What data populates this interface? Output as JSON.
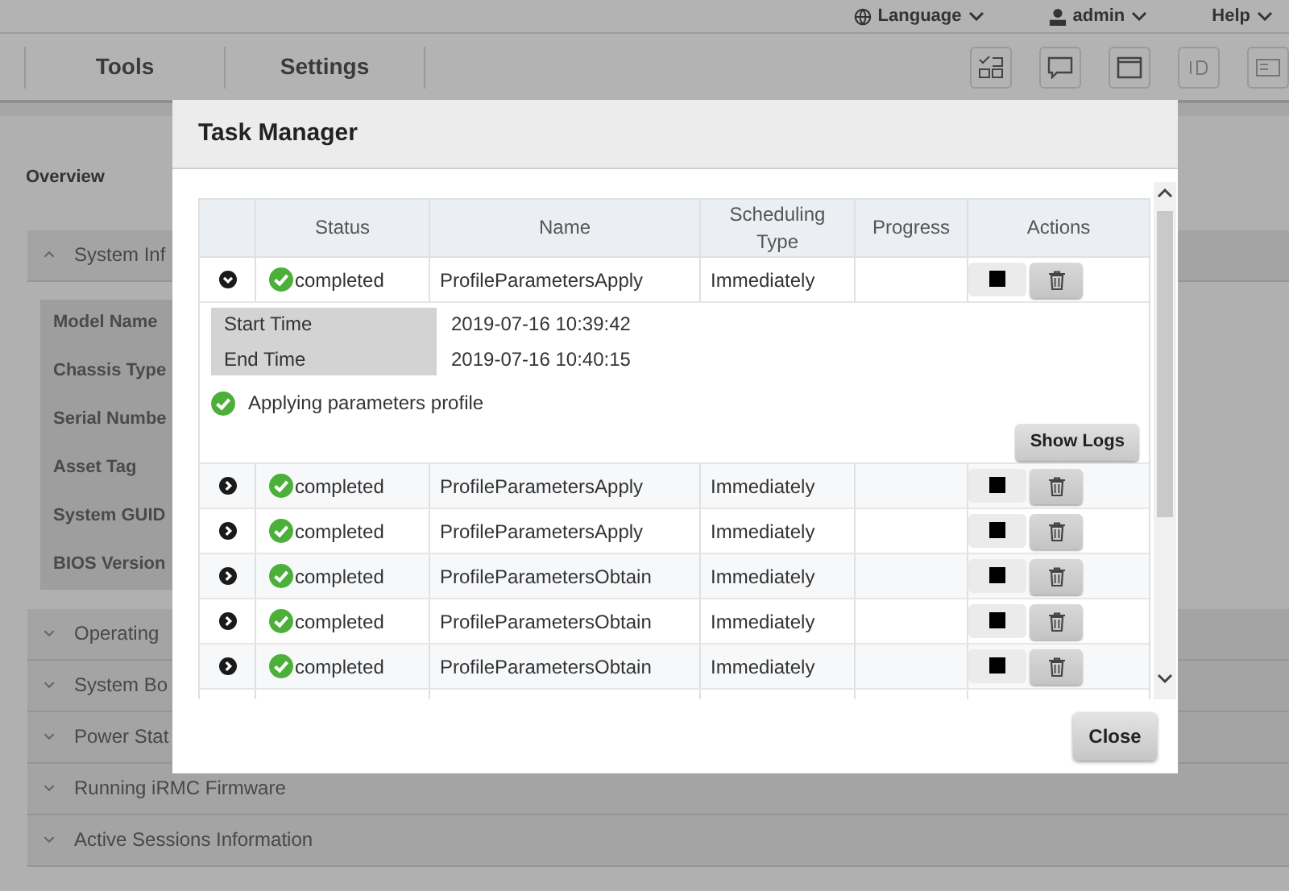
{
  "top_bar": {
    "items": [
      {
        "kind": "language",
        "label": "Language"
      },
      {
        "kind": "user",
        "label": "admin"
      },
      {
        "kind": "help",
        "label": "Help"
      }
    ]
  },
  "nav": {
    "tabs": [
      {
        "label": "Tools"
      },
      {
        "label": "Settings"
      }
    ]
  },
  "sidebar": {
    "title": "Overview"
  },
  "sections": [
    {
      "title": "System Inf",
      "expanded": true,
      "fields": [
        "Model Name",
        "Chassis Type",
        "Serial Numbe",
        "Asset Tag",
        "System GUID",
        "BIOS Version"
      ]
    },
    {
      "title": "Operating",
      "expanded": false
    },
    {
      "title": "System Bo",
      "expanded": false
    },
    {
      "title": "Power Stat",
      "expanded": false
    },
    {
      "title": "Running iRMC Firmware",
      "expanded": false
    },
    {
      "title": "Active Sessions Information",
      "expanded": false
    }
  ],
  "dialog": {
    "title": "Task Manager",
    "table": {
      "columns": [
        "",
        "Status",
        "Name",
        "Scheduling Type",
        "Progress",
        "Actions"
      ],
      "rows": [
        {
          "expanded": true,
          "status": "completed",
          "name": "ProfileParametersApply",
          "scheduling": "Immediately",
          "details": {
            "start_label": "Start Time",
            "start_value": "2019-07-16 10:39:42",
            "end_label": "End Time",
            "end_value": "2019-07-16 10:40:15",
            "message": "Applying parameters profile",
            "button": "Show Logs"
          }
        },
        {
          "expanded": false,
          "status": "completed",
          "name": "ProfileParametersApply",
          "scheduling": "Immediately"
        },
        {
          "expanded": false,
          "status": "completed",
          "name": "ProfileParametersApply",
          "scheduling": "Immediately"
        },
        {
          "expanded": false,
          "status": "completed",
          "name": "ProfileParametersObtain",
          "scheduling": "Immediately"
        },
        {
          "expanded": false,
          "status": "completed",
          "name": "ProfileParametersObtain",
          "scheduling": "Immediately"
        },
        {
          "expanded": false,
          "status": "completed",
          "name": "ProfileParametersObtain",
          "scheduling": "Immediately"
        }
      ]
    },
    "close_button": "Close"
  }
}
